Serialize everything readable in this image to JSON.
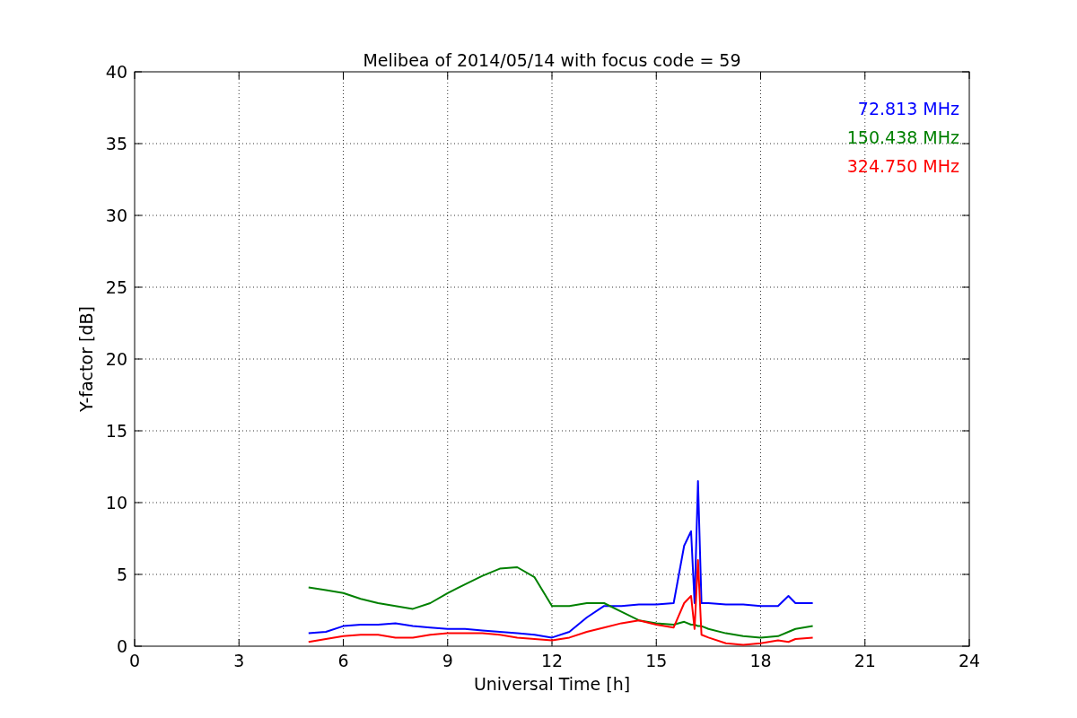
{
  "chart_data": {
    "type": "line",
    "grid": true,
    "title": "Melibea of 2014/05/14 with focus code = 59",
    "xlabel": "Universal Time [h]",
    "ylabel": "Y-factor [dB]",
    "xlim": [
      0,
      24
    ],
    "ylim": [
      0,
      40
    ],
    "xticks": [
      0,
      3,
      6,
      9,
      12,
      15,
      18,
      21,
      24
    ],
    "yticks": [
      0,
      5,
      10,
      15,
      20,
      25,
      30,
      35,
      40
    ],
    "x": [
      5,
      5.5,
      6,
      6.5,
      7,
      7.5,
      8,
      8.5,
      9,
      9.5,
      10,
      10.5,
      11,
      11.5,
      12,
      12.5,
      13,
      13.5,
      14,
      14.5,
      15,
      15.5,
      15.8,
      16,
      16.1,
      16.2,
      16.3,
      16.5,
      17,
      17.5,
      18,
      18.5,
      18.8,
      19,
      19.5
    ],
    "series": [
      {
        "name": "72.813 MHz",
        "color": "#0000ff",
        "values": [
          0.9,
          1.0,
          1.4,
          1.5,
          1.5,
          1.6,
          1.4,
          1.3,
          1.2,
          1.2,
          1.1,
          1.0,
          0.9,
          0.8,
          0.6,
          1.0,
          2.0,
          2.8,
          2.8,
          2.9,
          2.9,
          3.0,
          7.0,
          8.0,
          3.0,
          11.5,
          3.0,
          3.0,
          2.9,
          2.9,
          2.8,
          2.8,
          3.5,
          3.0,
          3.0
        ]
      },
      {
        "name": "150.438 MHz",
        "color": "#008000",
        "values": [
          4.1,
          3.9,
          3.7,
          3.3,
          3.0,
          2.8,
          2.6,
          3.0,
          3.7,
          4.3,
          4.9,
          5.4,
          5.5,
          4.8,
          2.8,
          2.8,
          3.0,
          3.0,
          2.4,
          1.8,
          1.6,
          1.5,
          1.7,
          1.5,
          1.5,
          1.4,
          1.4,
          1.2,
          0.9,
          0.7,
          0.6,
          0.7,
          1.0,
          1.2,
          1.4
        ]
      },
      {
        "name": "324.750 MHz",
        "color": "#ff0000",
        "values": [
          0.3,
          0.5,
          0.7,
          0.8,
          0.8,
          0.6,
          0.6,
          0.8,
          0.9,
          0.9,
          0.9,
          0.8,
          0.6,
          0.5,
          0.4,
          0.6,
          1.0,
          1.3,
          1.6,
          1.8,
          1.5,
          1.3,
          3.0,
          3.5,
          1.2,
          6.0,
          0.8,
          0.6,
          0.2,
          0.1,
          0.2,
          0.4,
          0.3,
          0.5,
          0.6
        ]
      }
    ]
  }
}
